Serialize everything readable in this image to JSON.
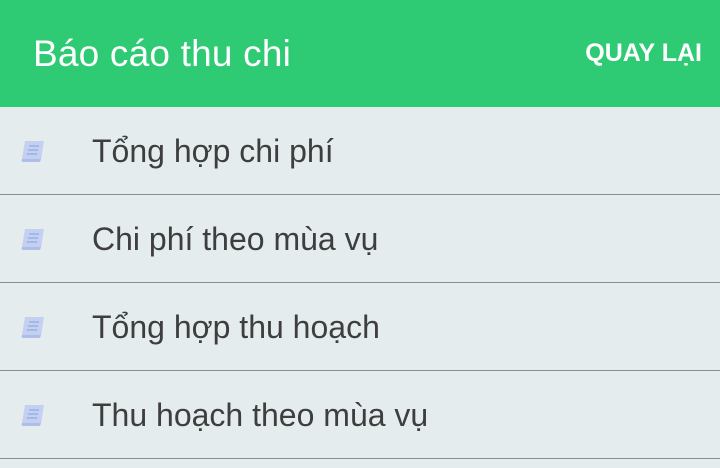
{
  "header": {
    "title": "Báo cáo thu chi",
    "back_label": "QUAY LẠI"
  },
  "menu": {
    "items": [
      {
        "label": "Tổng hợp chi phí",
        "icon": "book-icon"
      },
      {
        "label": "Chi phí theo mùa vụ",
        "icon": "book-icon"
      },
      {
        "label": "Tổng hợp thu hoạch",
        "icon": "book-icon"
      },
      {
        "label": "Thu hoạch theo mùa vụ",
        "icon": "book-icon"
      }
    ]
  },
  "colors": {
    "header_bg": "#2fca74",
    "list_bg": "#e4ecee",
    "icon": "#b9c7f0",
    "text": "#3e3e3e"
  }
}
